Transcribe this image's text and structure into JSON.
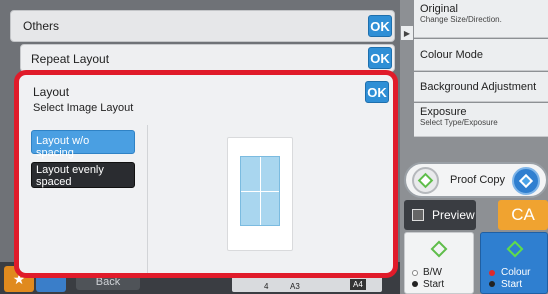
{
  "others_panel": {
    "title": "Others",
    "ok": "OK"
  },
  "repeat_panel": {
    "title": "Repeat Layout",
    "ok": "OK"
  },
  "layout_panel": {
    "title": "Layout",
    "subtitle": "Select Image Layout",
    "ok": "OK",
    "options": [
      {
        "label": "Layout w/o spacing",
        "selected": true
      },
      {
        "label": "Layout evenly spaced",
        "selected": false
      }
    ]
  },
  "right_menu": {
    "original": {
      "label": "Original",
      "sub": "Change Size/Direction."
    },
    "colour_mode": {
      "label": "Colour Mode"
    },
    "background": {
      "label": "Background Adjustment"
    },
    "exposure": {
      "label": "Exposure",
      "sub": "Select Type/Exposure"
    }
  },
  "actions": {
    "proof_copy": "Proof Copy",
    "preview": "Preview",
    "ca": "CA",
    "bw_start_line1": "B/W",
    "bw_start_line2": "Start",
    "colour_start_line1": "Colour",
    "colour_start_line2": "Start"
  },
  "background_bar": {
    "back": "Back",
    "tray_4": "4",
    "tray_a3": "A3",
    "tray_a4": "A4"
  },
  "colors": {
    "ok_blue": "#2f8fd6",
    "highlight_red": "#e01b2a",
    "selected_option": "#4a9fe2",
    "ca_orange": "#f0a330",
    "colour_start_blue": "#2f7fd0"
  }
}
